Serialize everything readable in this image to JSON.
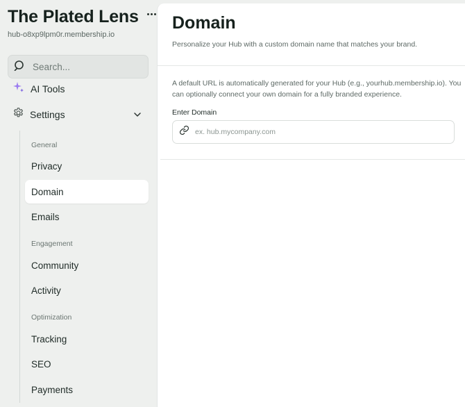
{
  "hub": {
    "title": "The Plated Lens",
    "url": "hub-o8xp9lpm0r.membership.io"
  },
  "search": {
    "placeholder": "Search..."
  },
  "sidebar": {
    "ai_tools_label": "AI Tools",
    "settings_label": "Settings",
    "groups": [
      {
        "label": "General",
        "items": [
          "Privacy",
          "Domain",
          "Emails"
        ]
      },
      {
        "label": "Engagement",
        "items": [
          "Community",
          "Activity"
        ]
      },
      {
        "label": "Optimization",
        "items": [
          "Tracking",
          "SEO",
          "Payments"
        ]
      }
    ],
    "active_item": "Domain"
  },
  "main": {
    "title": "Domain",
    "subtitle": "Personalize your Hub with a custom domain name that matches your brand.",
    "description": "A default URL is automatically generated for your Hub (e.g., yourhub.membership.io). You can optionally connect your own domain for a fully branded experience.",
    "field_label": "Enter Domain",
    "field_value": "",
    "field_placeholder": "ex. hub.mycompany.com"
  },
  "colors": {
    "sidebar_bg": "#eef0ee",
    "panel_bg": "#ffffff",
    "text": "#1e2a26",
    "ai_sparkle": "#9b7cf0"
  }
}
